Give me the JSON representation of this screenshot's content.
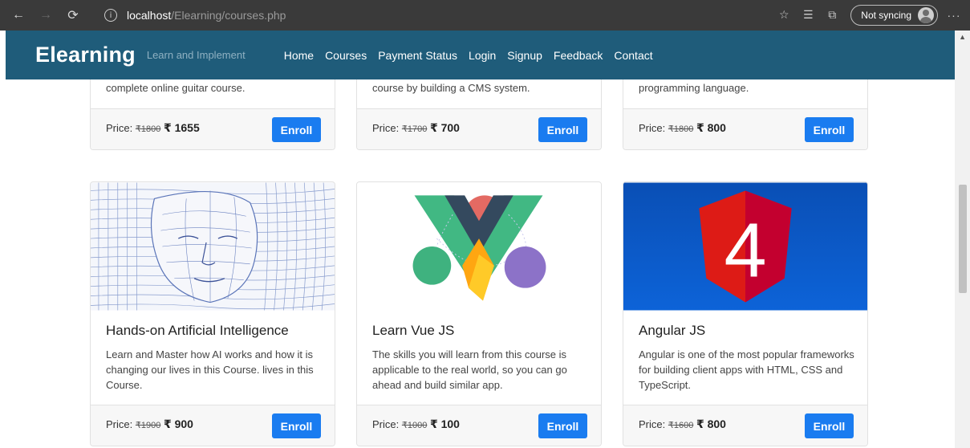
{
  "browser": {
    "url_host": "localhost",
    "url_path": "/Elearning/courses.php",
    "sync_label": "Not syncing",
    "icons": [
      "back-icon",
      "forward-icon",
      "refresh-icon",
      "info-icon",
      "favorite-icon",
      "favorites-list-icon",
      "collections-icon",
      "profile-icon",
      "more-icon"
    ]
  },
  "site": {
    "brand": "Elearning",
    "tagline": "Learn and Implement",
    "nav": [
      "Home",
      "Courses",
      "Payment Status",
      "Login",
      "Signup",
      "Feedback",
      "Contact"
    ]
  },
  "price_label": "Price:",
  "enroll_label": "Enroll",
  "top_cards": [
    {
      "desc_tail": "complete online guitar course.",
      "old_price": "₹1800",
      "new_price": "₹ 1655"
    },
    {
      "desc_tail": "course by building a CMS system.",
      "old_price": "₹1700",
      "new_price": "₹ 700"
    },
    {
      "desc_tail": "programming language.",
      "old_price": "₹1800",
      "new_price": "₹ 800"
    }
  ],
  "courses": [
    {
      "title": "Hands-on Artificial Intelligence",
      "desc": "Learn and Master how AI works and how it is changing our lives in this Course. lives in this Course.",
      "old_price": "₹1900",
      "new_price": "₹ 900",
      "image": "ai-wireframe-face-image"
    },
    {
      "title": "Learn Vue JS",
      "desc": "The skills you will learn from this course is applicable to the real world, so you can go ahead and build similar app.",
      "old_price": "₹1000",
      "new_price": "₹ 100",
      "image": "vue-firebase-logo-image"
    },
    {
      "title": "Angular JS",
      "desc": "Angular is one of the most popular frameworks for building client apps with HTML, CSS and TypeScript.",
      "old_price": "₹1600",
      "new_price": "₹ 800",
      "image": "angular-4-logo-image",
      "logo_text": "4"
    }
  ],
  "colors": {
    "navbar": "#1f5c7a",
    "button": "#1a7cf0",
    "angular_bg": "#0b5bc4",
    "angular_shield": "#dd1b16"
  }
}
